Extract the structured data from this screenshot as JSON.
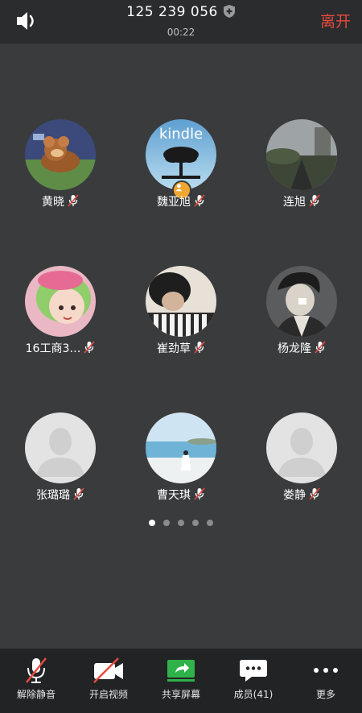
{
  "header": {
    "meeting_id": "125 239 056",
    "timer": "00:22",
    "leave_label": "离开"
  },
  "participants": [
    {
      "name": "黄晓",
      "muted": true,
      "avatar": "cartoon-mouse"
    },
    {
      "name": "魏亚旭",
      "muted": true,
      "avatar": "kindle-tree",
      "host": true
    },
    {
      "name": "连旭",
      "muted": true,
      "avatar": "road-scene"
    },
    {
      "name": "16工商3…",
      "muted": true,
      "avatar": "anime-girl"
    },
    {
      "name": "崔劲草",
      "muted": true,
      "avatar": "piano-child"
    },
    {
      "name": "杨龙隆",
      "muted": true,
      "avatar": "comic-man"
    },
    {
      "name": "张璐璐",
      "muted": true,
      "avatar": "default"
    },
    {
      "name": "曹天琪",
      "muted": true,
      "avatar": "beach-photo"
    },
    {
      "name": "娄静",
      "muted": true,
      "avatar": "default"
    }
  ],
  "avatar_texts": {
    "kindle": "kindle"
  },
  "pagination": {
    "pages": 5,
    "active": 1
  },
  "toolbar": {
    "unmute_label": "解除静音",
    "video_label": "开启视频",
    "share_label": "共享屏幕",
    "members_label": "成员(41)",
    "more_label": "更多"
  },
  "colors": {
    "background": "#3a3b3d",
    "topbar": "#2b2c2e",
    "bottombar": "#222325",
    "leave": "#e84a3f",
    "share_green": "#2fb24a",
    "host_badge": "#f0a732"
  }
}
